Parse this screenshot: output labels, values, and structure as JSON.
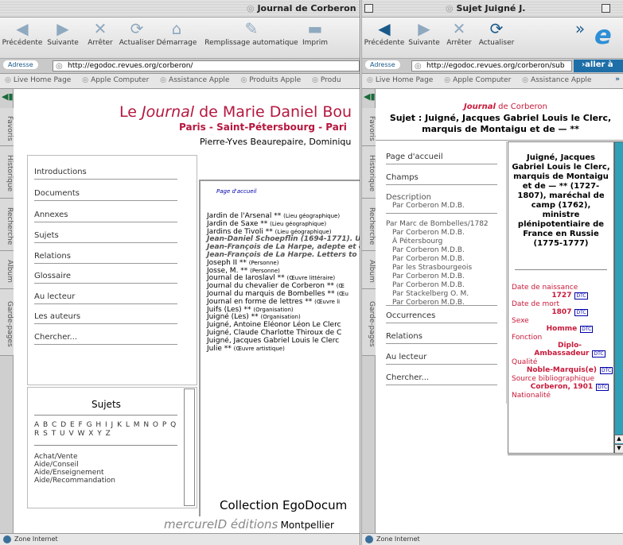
{
  "window1": {
    "title": "Journal de Corberon",
    "toolbar": [
      "Précédente",
      "Suivante",
      "Arrêter",
      "Actualiser",
      "Démarrage",
      "Remplissage automatique",
      "Imprim"
    ],
    "address_label": "Adresse",
    "url": "http://egodoc.revues.org/corberon/",
    "favorites": [
      "Live Home Page",
      "Apple Computer",
      "Assistance Apple",
      "Produits Apple",
      "Produ"
    ],
    "sidetabs": [
      "Favoris",
      "Historique",
      "Recherche",
      "Album",
      "Garde-pages"
    ],
    "header": {
      "title_pre": "Le ",
      "title_em": "Journal",
      "title_post": " de Marie Daniel Bou",
      "subtitle": "Paris - Saint-Pétersbourg - Pari",
      "authors": "Pierre-Yves Beaurepaire, Dominiqu"
    },
    "nav": [
      "Introductions",
      "Documents",
      "Annexes",
      "Sujets",
      "Relations",
      "Glossaire",
      "Au lecteur",
      "Les auteurs",
      "Chercher..."
    ],
    "home_link": "Page d'accueil",
    "index": [
      {
        "name": "Jardin de l'Arsenal **",
        "type": "(Lieu géographique)"
      },
      {
        "name": "Jardin de Saxe **",
        "type": "(Lieu géographique)"
      },
      {
        "name": "Jardins de Tivoli **",
        "type": "(Lieu géographique)"
      },
      {
        "name": "Jean-Daniel Schoepflin (1694-1771). Un",
        "type": ""
      },
      {
        "name": "Jean-François de La Harpe, adepte et c",
        "type": ""
      },
      {
        "name": "Jean-François de La Harpe. Letters to",
        "type": ""
      },
      {
        "name": "Joseph II **",
        "type": "(Personne)"
      },
      {
        "name": "Josse, M. **",
        "type": "(Personne)"
      },
      {
        "name": "Journal de Iaroslavl **",
        "type": "(Œuvre littéraire)"
      },
      {
        "name": "Journal du chevalier de Corberon **",
        "type": "(Œ"
      },
      {
        "name": "Journal du marquis de Bombelles **",
        "type": "(Œu"
      },
      {
        "name": "Journal en forme de lettres **",
        "type": "(Œuvre li"
      },
      {
        "name": "Juifs (Les) **",
        "type": "(Organisation)"
      },
      {
        "name": "Juigné (Les) **",
        "type": "(Organisation)"
      },
      {
        "name": "Juigné, Antoine Eléonor Léon Le Clerc",
        "type": ""
      },
      {
        "name": "Juigné, Claude Charlotte Thiroux de C",
        "type": ""
      },
      {
        "name": "Juigné, Jacques Gabriel Louis le Clerc",
        "type": ""
      },
      {
        "name": "Julie **",
        "type": "(Œuvre artistique)"
      }
    ],
    "sujets_title": "Sujets",
    "alphabet": "A B C D E F G H I J K L M N O P Q R S T U V W X Y Z",
    "sujets_list": [
      "Achat/Vente",
      "Aide/Conseil",
      "Aide/Enseignement",
      "Aide/Recommandation"
    ],
    "footer1": "Collection EgoDocum",
    "footer2": "mercureID éditions",
    "footer3": "Montpellier",
    "status": "Zone Internet"
  },
  "window2": {
    "title": "Sujet Juigné  J.",
    "toolbar": [
      "Précédente",
      "Suivante",
      "Arrêter",
      "Actualiser"
    ],
    "address_label": "Adresse",
    "url": "http://egodoc.revues.org/corberon/sub",
    "go": "aller à",
    "favorites": [
      "Live Home Page",
      "Apple Computer",
      "Assistance Apple"
    ],
    "sidetabs": [
      "Favoris",
      "Historique",
      "Recherche",
      "Album",
      "Garde-pages"
    ],
    "header": {
      "journal": "Journal",
      "de": " de Corberon",
      "subject": "Sujet : Juigné, Jacques Gabriel Louis le Clerc, marquis de Montaigu et de — **"
    },
    "nav_top": [
      "Page d'accueil",
      "Champs"
    ],
    "description_label": "Description",
    "description_by": "Par Corberon M.D.B.",
    "by_list": [
      "Par Marc de Bombelles/1782",
      "Par Corberon M.D.B.",
      "À Pétersbourg",
      "Par Corberon M.D.B.",
      "Par Corberon M.D.B.",
      "Par les Strasbourgeois",
      "Par Corberon M.D.B.",
      "Par Corberon M.D.B.",
      "Par Stackelberg O. M.",
      "Par Corberon M.D.B."
    ],
    "nav_bottom": [
      "Occurrences",
      "Relations",
      "Au lecteur",
      "Chercher..."
    ],
    "entry_title": "Juigné, Jacques Gabriel Louis le Clerc, marquis de Montaigu et de — ** (1727-1807), maréchal de camp (1762), ministre plénipotentiaire de France en Russie (1775-1777)",
    "fields": [
      {
        "label": "Date de naissance",
        "value": "1727",
        "tag": "DTC"
      },
      {
        "label": "Date de mort",
        "value": "1807",
        "tag": "DTC"
      },
      {
        "label": "Sexe",
        "value": "Homme",
        "tag": "DTC"
      },
      {
        "label": "Fonction",
        "value": "Diplo-Ambassadeur",
        "tag": "DTC"
      },
      {
        "label": "Qualité",
        "value": "Noble-Marquis(e)",
        "tag": "DTC"
      },
      {
        "label": "Source bibliographique",
        "value": "Corberon, 1901",
        "tag": "DTC"
      },
      {
        "label": "Nationalité",
        "value": "",
        "tag": ""
      }
    ],
    "status": "Zone Internet"
  }
}
